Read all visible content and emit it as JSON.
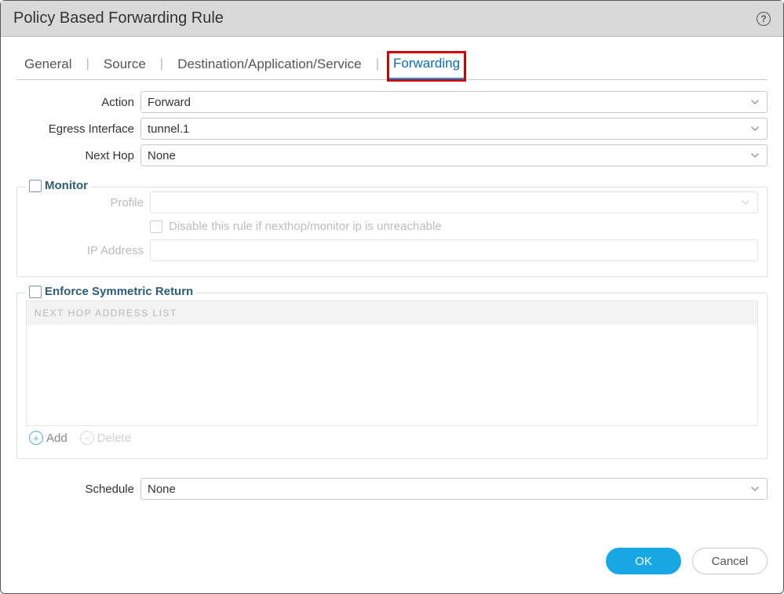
{
  "dialog": {
    "title": "Policy Based Forwarding Rule"
  },
  "tabs": {
    "general": "General",
    "source": "Source",
    "destination": "Destination/Application/Service",
    "forwarding": "Forwarding"
  },
  "fields": {
    "action": {
      "label": "Action",
      "value": "Forward"
    },
    "egress": {
      "label": "Egress Interface",
      "value": "tunnel.1"
    },
    "nexthop": {
      "label": "Next Hop",
      "value": "None"
    },
    "schedule": {
      "label": "Schedule",
      "value": "None"
    }
  },
  "monitor": {
    "legend": "Monitor",
    "profile_label": "Profile",
    "profile_value": "",
    "disable_label": "Disable this rule if nexthop/monitor ip is unreachable",
    "ip_label": "IP Address",
    "ip_value": ""
  },
  "symmetric": {
    "legend": "Enforce Symmetric Return",
    "list_header": "NEXT HOP ADDRESS LIST",
    "add_label": "Add",
    "delete_label": "Delete"
  },
  "footer": {
    "ok": "OK",
    "cancel": "Cancel"
  }
}
